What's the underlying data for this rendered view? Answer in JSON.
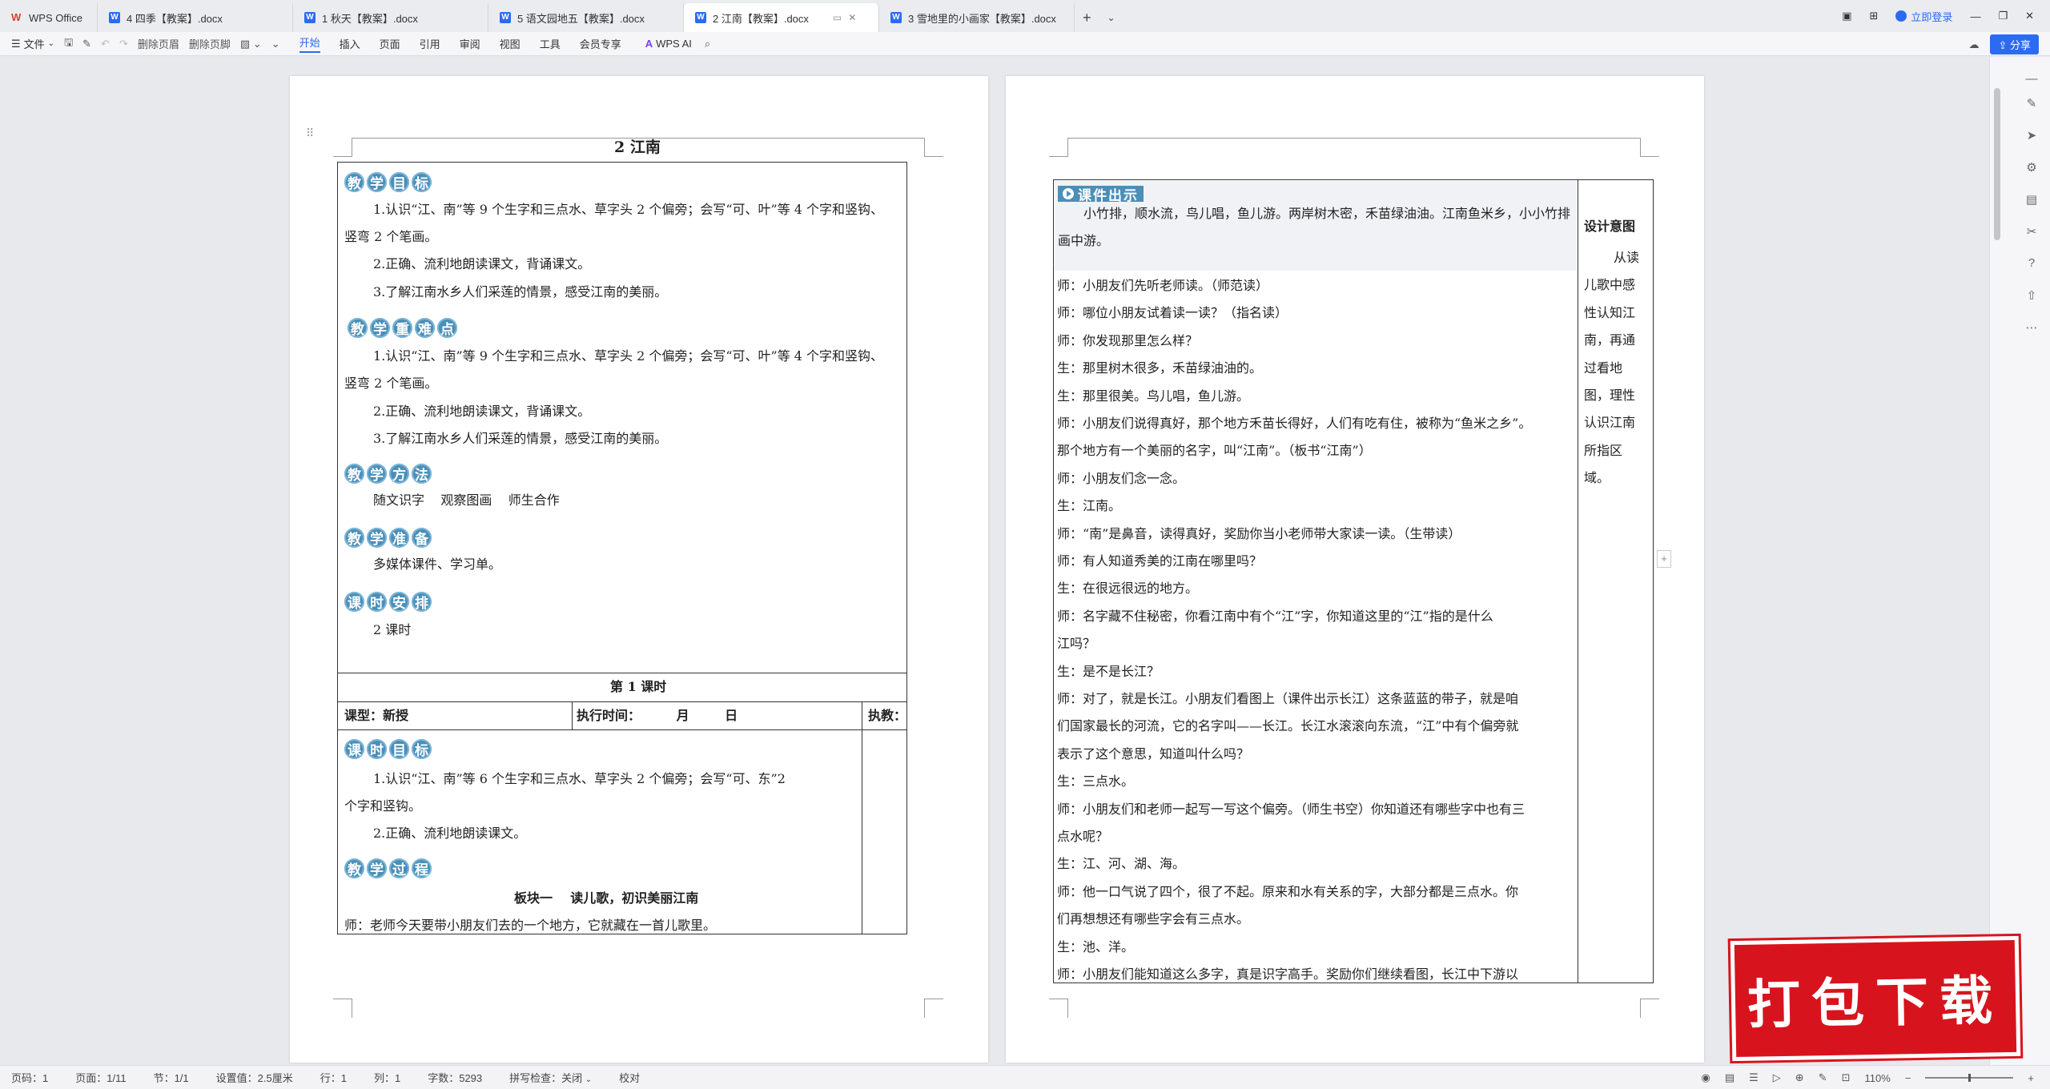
{
  "tabs": [
    {
      "label": "WPS Office",
      "type": "home"
    },
    {
      "label": "4 四季【教案】.docx"
    },
    {
      "label": "1 秋天【教案】.docx"
    },
    {
      "label": "5 语文园地五【教案】.docx"
    },
    {
      "label": "2 江南【教案】.docx",
      "active": true
    },
    {
      "label": "3 雪地里的小画家【教案】.docx"
    }
  ],
  "titlebar": {
    "login": "立即登录"
  },
  "menubar": {
    "file": "文件",
    "delete_header": "删除页眉",
    "delete_footer": "删除页脚",
    "menus": [
      "开始",
      "插入",
      "页面",
      "引用",
      "审阅",
      "视图",
      "工具",
      "会员专享"
    ],
    "wps_ai": "WPS AI",
    "share": "分享"
  },
  "page1": {
    "title": "2 江南",
    "s1_badge": [
      "教",
      "学",
      "目",
      "标"
    ],
    "s1_lines": [
      "1.认识“江、南”等 9 个生字和三点水、草字头 2 个偏旁；会写“可、叶”等 4 个字和竖钩、",
      "竖弯 2 个笔画。",
      "2.正确、流利地朗读课文，背诵课文。",
      "3.了解江南水乡人们采莲的情景，感受江南的美丽。"
    ],
    "s2_badge": [
      "教",
      "学",
      "重",
      "难",
      "点"
    ],
    "s2_lines": [
      "1.认识“江、南”等 9 个生字和三点水、草字头 2 个偏旁；会写“可、叶”等 4 个字和竖钩、",
      "竖弯 2 个笔画。",
      "2.正确、流利地朗读课文，背诵课文。",
      "3.了解江南水乡人们采莲的情景，感受江南的美丽。"
    ],
    "s3_badge": [
      "教",
      "学",
      "方",
      "法"
    ],
    "s3_text": "随文识字    观察图画    师生合作",
    "s4_badge": [
      "教",
      "学",
      "准",
      "备"
    ],
    "s4_text": "多媒体课件、学习单。",
    "s5_badge": [
      "课",
      "时",
      "安",
      "排"
    ],
    "s5_text": "2 课时",
    "lesson_title": "第 1 课时",
    "course_type": "课型：新授",
    "exec_time": "执行时间：        月        日",
    "teach": "执教：",
    "s6_badge": [
      "课",
      "时",
      "目",
      "标"
    ],
    "s6_lines": [
      "1.认识“江、南”等 6 个生字和三点水、草字头 2 个偏旁；会写“可、东”2",
      "个字和竖钩。",
      "2.正确、流利地朗读课文。"
    ],
    "s7_badge": [
      "教",
      "学",
      "过",
      "程"
    ],
    "block_title": "板块一    读儿歌，初识美丽江南",
    "last_line": "师：老师今天要带小朋友们去的一个地方，它就藏在一首儿歌里。"
  },
  "page2": {
    "courseware_label": "课件出示",
    "courseware_text": "小竹排，顺水流，鸟儿唱，鱼儿游。两岸树木密，禾苗绿油油。江南鱼米乡，小小竹排画中游。",
    "lines": [
      "师：小朋友们先听老师读。（师范读）",
      "师：哪位小朋友试着读一读？（指名读）",
      "师：你发现那里怎么样？",
      "生：那里树木很多，禾苗绿油油的。",
      "生：那里很美。鸟儿唱，鱼儿游。",
      "师：小朋友们说得真好，那个地方禾苗长得好，人们有吃有住，被称为“鱼米之乡”。",
      "那个地方有一个美丽的名字，叫“江南”。（板书“江南”）",
      "师：小朋友们念一念。",
      "生：江南。",
      "师：“南”是鼻音，读得真好，奖励你当小老师带大家读一读。（生带读）",
      "师：有人知道秀美的江南在哪里吗？",
      "生：在很远很远的地方。",
      "师：名字藏不住秘密，你看江南中有个“江”字，你知道这里的“江”指的是什么",
      "江吗？",
      "生：是不是长江？",
      "师：对了，就是长江。小朋友们看图上（课件出示长江）这条蓝蓝的带子，就是咱",
      "们国家最长的河流，它的名字叫——长江。长江水滚滚向东流，“江”中有个偏旁就",
      "表示了这个意思，知道叫什么吗？",
      "生：三点水。",
      "师：小朋友们和老师一起写一写这个偏旁。（师生书空）你知道还有哪些字中也有三",
      "点水呢？",
      "生：江、河、湖、海。",
      "师：他一口气说了四个，很了不起。原来和水有关系的字，大部分都是三点水。你",
      "们再想想还有哪些字会有三点水。",
      "生：池、洋。",
      "师：小朋友们能知道这么多字，真是识字高手。奖励你们继续看图，长江中下游以"
    ],
    "design_title": "设计意图",
    "design_lines": [
      "从读",
      "儿歌中感",
      "性认知江",
      "南，再通",
      "过看地",
      "图，理性",
      "认识江南",
      "所指区",
      "域。"
    ]
  },
  "statusbar": {
    "page_no": "页码：1",
    "page_count": "页面：1/11",
    "section": "节：1/1",
    "setting": "设置值：2.5厘米",
    "row": "行：1",
    "col": "列：1",
    "word_count": "字数：5293",
    "spellcheck": "拼写检查：关闭",
    "proofread": "校对",
    "zoom": "110%"
  },
  "promo": {
    "text": "打包下载"
  },
  "colors": {
    "accent": "#2b6bf3",
    "badge": "#4a8fb8",
    "promo": "#d7141d"
  }
}
